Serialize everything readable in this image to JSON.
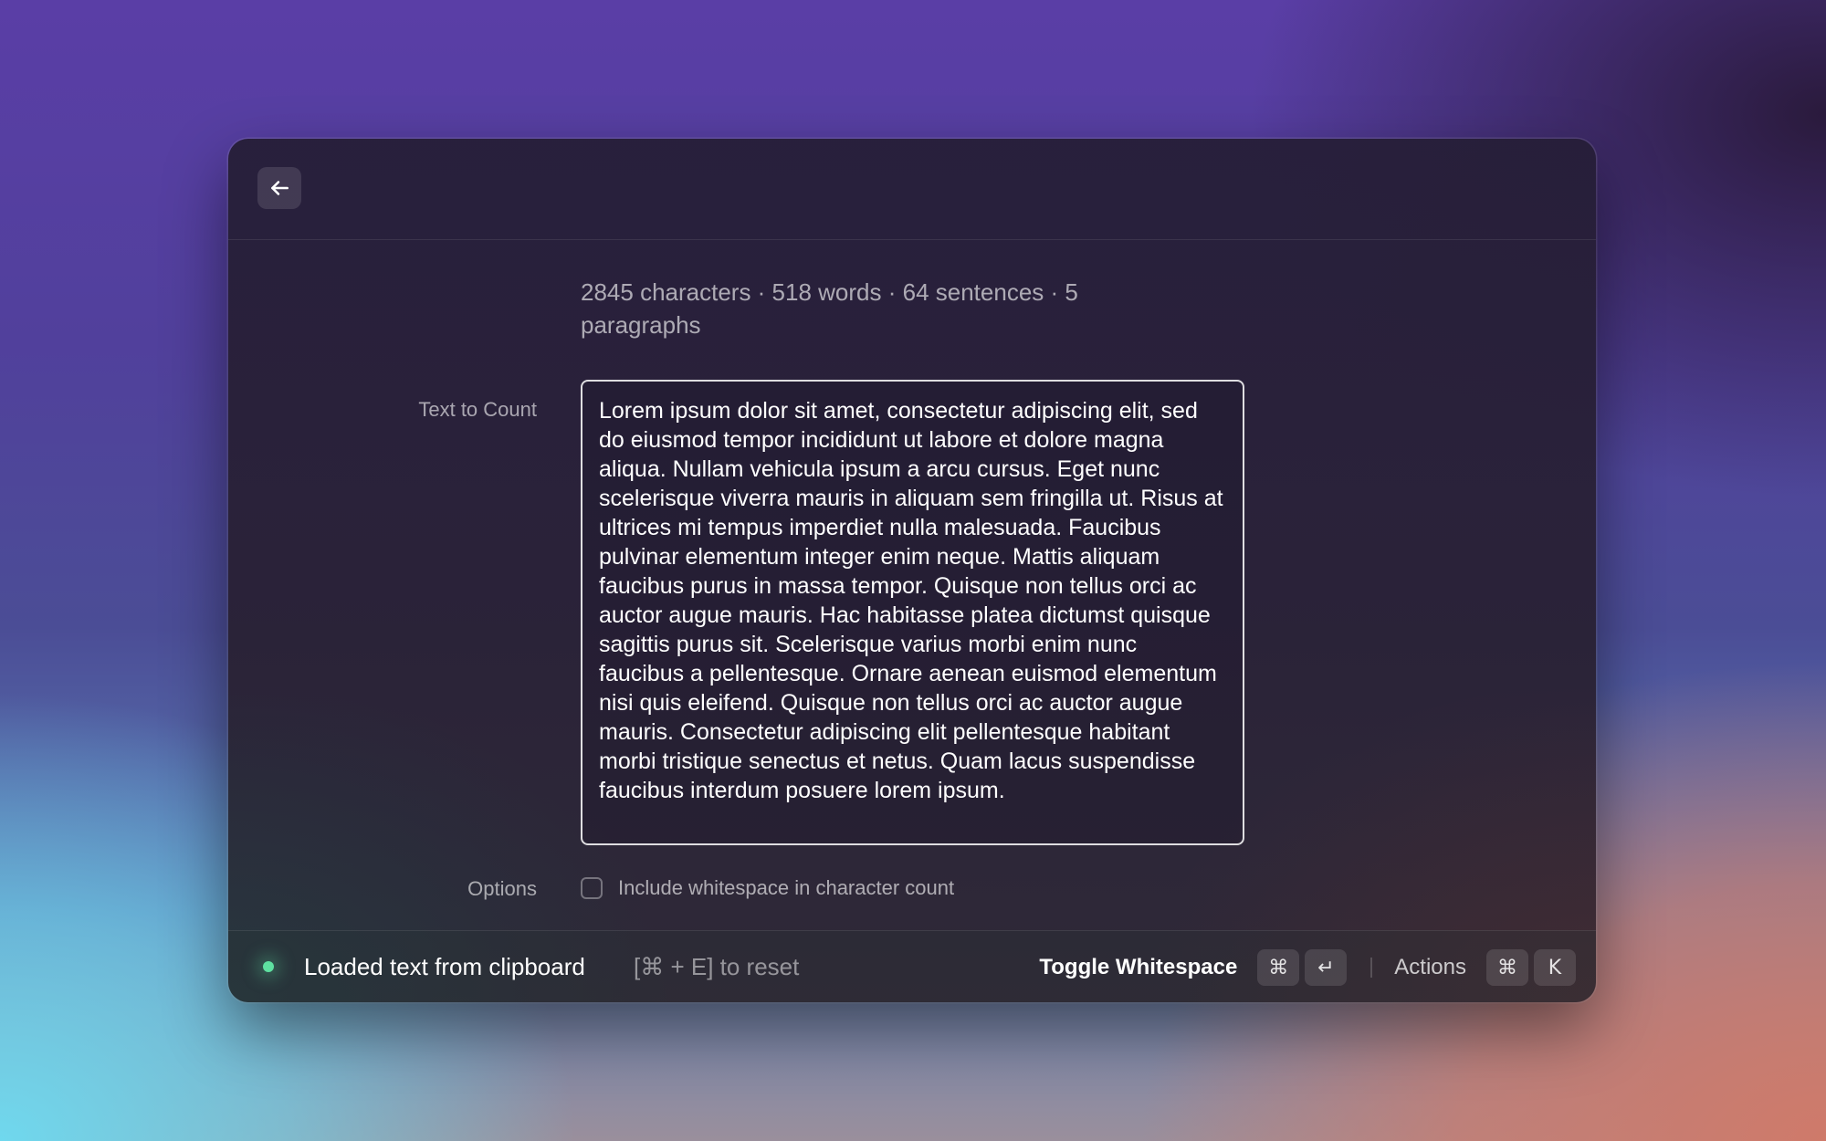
{
  "window": {
    "back_icon": "arrow-left-icon"
  },
  "stats": {
    "text": "2845 characters · 518 words · 64 sentences · 5 paragraphs"
  },
  "form": {
    "text_label": "Text to Count",
    "text_value": "Lorem ipsum dolor sit amet, consectetur adipiscing elit, sed do eiusmod tempor incididunt ut labore et dolore magna aliqua. Nullam vehicula ipsum a arcu cursus. Eget nunc scelerisque viverra mauris in aliquam sem fringilla ut. Risus at ultrices mi tempus imperdiet nulla malesuada. Faucibus pulvinar elementum integer enim neque. Mattis aliquam faucibus purus in massa tempor. Quisque non tellus orci ac auctor augue mauris. Hac habitasse platea dictumst quisque sagittis purus sit. Scelerisque varius morbi enim nunc faucibus a pellentesque. Ornare aenean euismod elementum nisi quis eleifend. Quisque non tellus orci ac auctor augue mauris. Consectetur adipiscing elit pellentesque habitant morbi tristique senectus et netus. Quam lacus suspendisse faucibus interdum posuere lorem ipsum.",
    "options_label": "Options",
    "whitespace_checkbox_label": "Include whitespace in character count",
    "whitespace_checked": false
  },
  "footer": {
    "status_text": "Loaded text from clipboard",
    "status_color": "#5ee0a0",
    "reset_hint": "[⌘ + E] to reset",
    "primary_action": "Toggle Whitespace",
    "primary_keys": [
      "⌘",
      "↵"
    ],
    "secondary_action": "Actions",
    "secondary_keys": [
      "⌘",
      "K"
    ]
  }
}
